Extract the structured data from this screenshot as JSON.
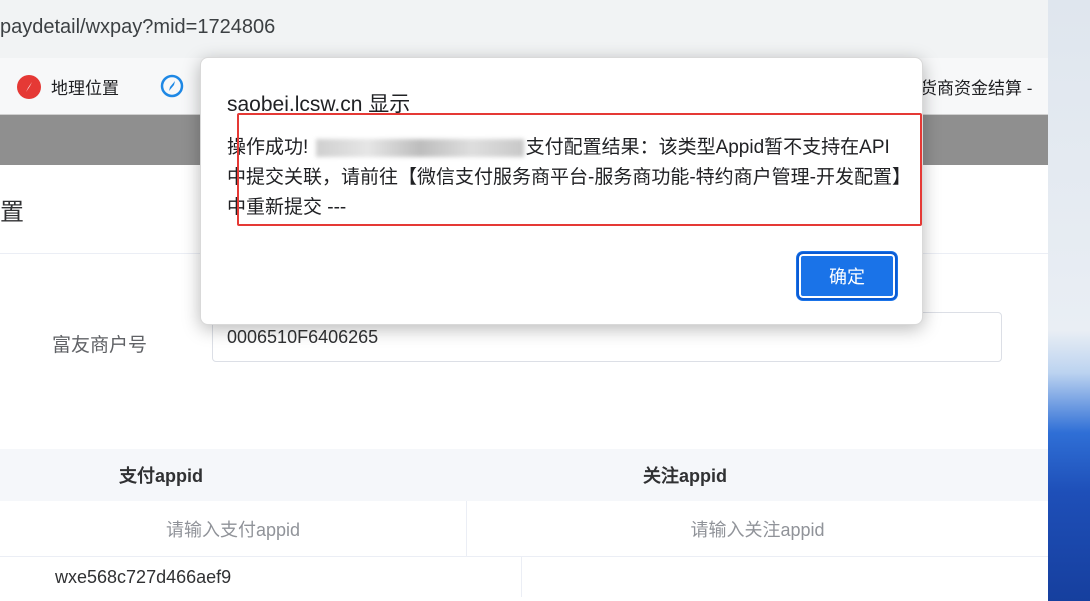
{
  "browser": {
    "url": "paydetail/wxpay?mid=1724806",
    "bookmarks": [
      {
        "label": "地理位置",
        "icon": "red-compass-icon"
      },
      {
        "label": "",
        "icon": "blue-circle-icon"
      },
      {
        "label": "货商资金结算 -",
        "icon": ""
      }
    ]
  },
  "page": {
    "title": "置",
    "merchant_label": "富友商户号",
    "merchant_value": "0006510F6406265"
  },
  "table": {
    "headers": [
      "支付appid",
      "关注appid"
    ],
    "input_row": [
      "请输入支付appid",
      "请输入关注appid"
    ],
    "data_row": [
      "wxe568c727d466aef9",
      ""
    ]
  },
  "dialog": {
    "title": "saobei.lcsw.cn 显示",
    "message_prefix": "操作成功!",
    "message_body": "支付配置结果：该类型Appid暂不支持在API中提交关联，请前往【微信支付服务商平台-服务商功能-特约商户管理-开发配置】中重新提交 ---",
    "ok_label": "确定"
  },
  "colors": {
    "accent": "#1a73e8",
    "highlight": "#e53935"
  }
}
